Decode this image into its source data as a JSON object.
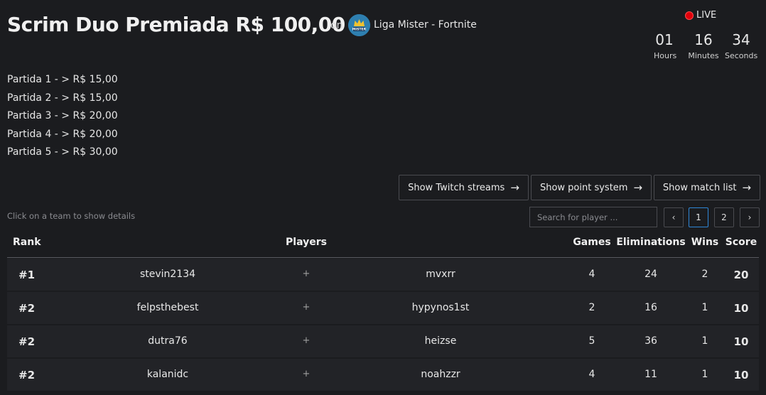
{
  "header": {
    "title": "Scrim Duo Premiada R$ 100,00",
    "on": "on",
    "org_name": "Liga Mister - Fortnite",
    "org_logo_text": "MISTER"
  },
  "live": {
    "label": "LIVE",
    "hours": "01",
    "hours_label": "Hours",
    "minutes": "16",
    "minutes_label": "Minutes",
    "seconds": "34",
    "seconds_label": "Seconds"
  },
  "prizes": [
    "Partida 1 - > R$ 15,00",
    "Partida 2 - > R$ 15,00",
    "Partida 3 - > R$ 20,00",
    "Partida 4 - > R$ 20,00",
    "Partida 5 - > R$ 30,00"
  ],
  "buttons": {
    "twitch": "Show Twitch streams",
    "points": "Show point system",
    "matches": "Show match list"
  },
  "hint": "Click on a team to show details",
  "search": {
    "placeholder": "Search for player ..."
  },
  "pagination": {
    "prev": "‹",
    "pages": [
      "1",
      "2"
    ],
    "current": "1",
    "next": "›"
  },
  "table": {
    "headers": {
      "rank": "Rank",
      "players": "Players",
      "games": "Games",
      "eliminations": "Eliminations",
      "wins": "Wins",
      "score": "Score"
    },
    "rows": [
      {
        "rank": "#1",
        "player1": "stevin2134",
        "sep": "+",
        "player2": "mvxrr",
        "games": "4",
        "eliminations": "24",
        "wins": "2",
        "score": "20"
      },
      {
        "rank": "#2",
        "player1": "felpsthebest",
        "sep": "+",
        "player2": "hypynos1st",
        "games": "2",
        "eliminations": "16",
        "wins": "1",
        "score": "10"
      },
      {
        "rank": "#2",
        "player1": "dutra76",
        "sep": "+",
        "player2": "heizse",
        "games": "5",
        "eliminations": "36",
        "wins": "1",
        "score": "10"
      },
      {
        "rank": "#2",
        "player1": "kalanidc",
        "sep": "+",
        "player2": "noahzzr",
        "games": "4",
        "eliminations": "11",
        "wins": "1",
        "score": "10"
      }
    ]
  },
  "colors": {
    "background": "#1b1c1f",
    "row": "#222327",
    "live_dot": "#e0000b",
    "active_page": "#2f86d6"
  },
  "icons": {
    "arrow": "arrow-right-icon",
    "live": "live-dot-icon"
  }
}
